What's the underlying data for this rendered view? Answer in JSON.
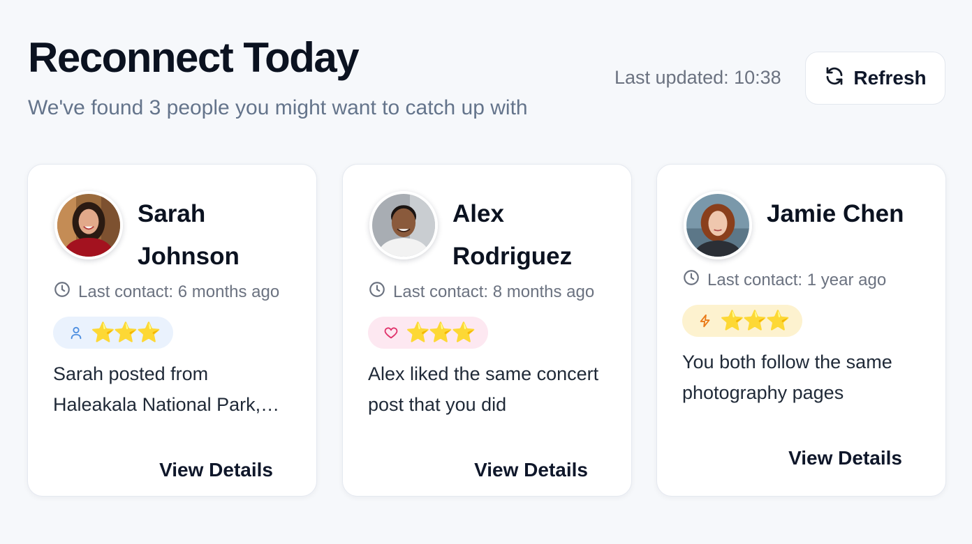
{
  "header": {
    "title": "Reconnect Today",
    "subtitle": "We've found 3 people you might want to catch up with",
    "last_updated": "Last updated: 10:38",
    "refresh_label": "Refresh"
  },
  "cards": [
    {
      "name": "Sarah Johnson",
      "last_contact": "Last contact: 6 months ago",
      "badge_icon": "user-icon",
      "badge_color": "#eaf2fd",
      "stars": "⭐⭐⭐",
      "rating": 3,
      "description": "Sarah posted from Haleakala National Park, Maui",
      "action": "View Details"
    },
    {
      "name": "Alex Rodriguez",
      "last_contact": "Last contact: 8 months ago",
      "badge_icon": "heart-icon",
      "badge_color": "#fde8f1",
      "stars": "⭐⭐⭐",
      "rating": 3,
      "description": "Alex liked the same concert post that you did",
      "action": "View Details"
    },
    {
      "name": "Jamie Chen",
      "last_contact": "Last contact: 1 year ago",
      "badge_icon": "lightning-icon",
      "badge_color": "#fdf2cf",
      "stars": "⭐⭐⭐",
      "rating": 3,
      "description": "You both follow the same photography pages",
      "action": "View Details"
    }
  ]
}
